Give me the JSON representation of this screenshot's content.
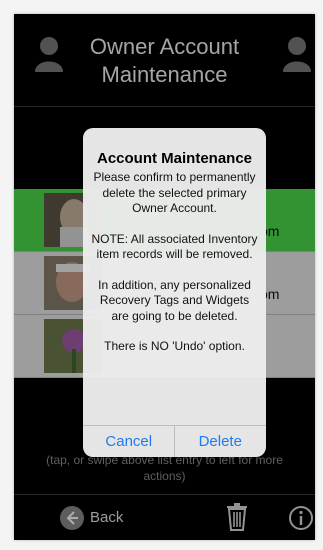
{
  "header": {
    "title_line1": "Owner Account",
    "title_line2": "Maintenance"
  },
  "list": {
    "rows": [
      {
        "name_fragment": "om",
        "selected": true
      },
      {
        "name_fragment": "om",
        "selected": false
      },
      {
        "name_fragment": "",
        "selected": false
      }
    ]
  },
  "hint": "(tap, or swipe above list entry to left for more actions)",
  "bottom_bar": {
    "back_label": "Back",
    "trash_icon": "trash-icon",
    "info_icon": "info-icon"
  },
  "dialog": {
    "title": "Account Maintenance",
    "para1": "Please confirm to permanently delete the selected primary Owner Account.",
    "para2": "NOTE: All associated Inventory item records will be removed.",
    "para3": "In addition, any personalized Recovery Tags and Widgets are going to be deleted.",
    "para4": "There is NO 'Undo' option.",
    "cancel_label": "Cancel",
    "delete_label": "Delete"
  },
  "colors": {
    "selected_row": "#4cd94c",
    "dialog_button": "#1e7cf2"
  }
}
